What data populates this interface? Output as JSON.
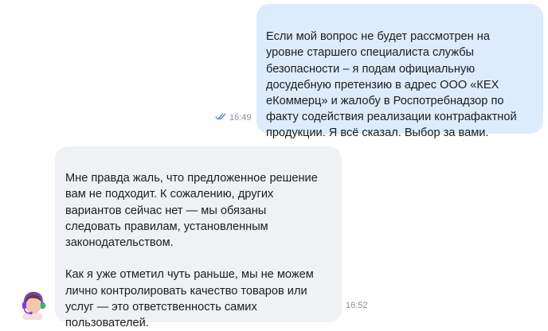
{
  "messages": [
    {
      "direction": "outgoing",
      "text": "Если мой вопрос не будет рассмотрен на\nуровне старшего специалиста службы\nбезопасности – я подам официальную\nдосудебную претензию в адрес ООО «КЕХ\neКоммерц» и жалобу в Роспотребнадзор по\nфакту содействия реализации контрафактной\nпродукции. Я всё сказал. Выбор за вами.",
      "time": "16:49",
      "status_icon": "double-check-icon"
    },
    {
      "direction": "incoming",
      "text": "Мне правда жаль, что предложенное решение\nвам не подходит. К сожалению, других\nвариантов сейчас нет — мы обязаны\nследовать правилам, установленным\nзаконодательством.\n\nКак я уже отметил чуть раньше, мы не можем\nлично контролировать качество товаров или\nуслуг — это ответственность самих\nпользователей.",
      "time": "16:52",
      "avatar_icon": "support-agent-avatar"
    }
  ],
  "colors": {
    "outgoing_bubble": "#dcecfd",
    "incoming_bubble": "#f0f1f4",
    "check_marks": "#3b82f6",
    "timestamp": "#8a8f98"
  }
}
